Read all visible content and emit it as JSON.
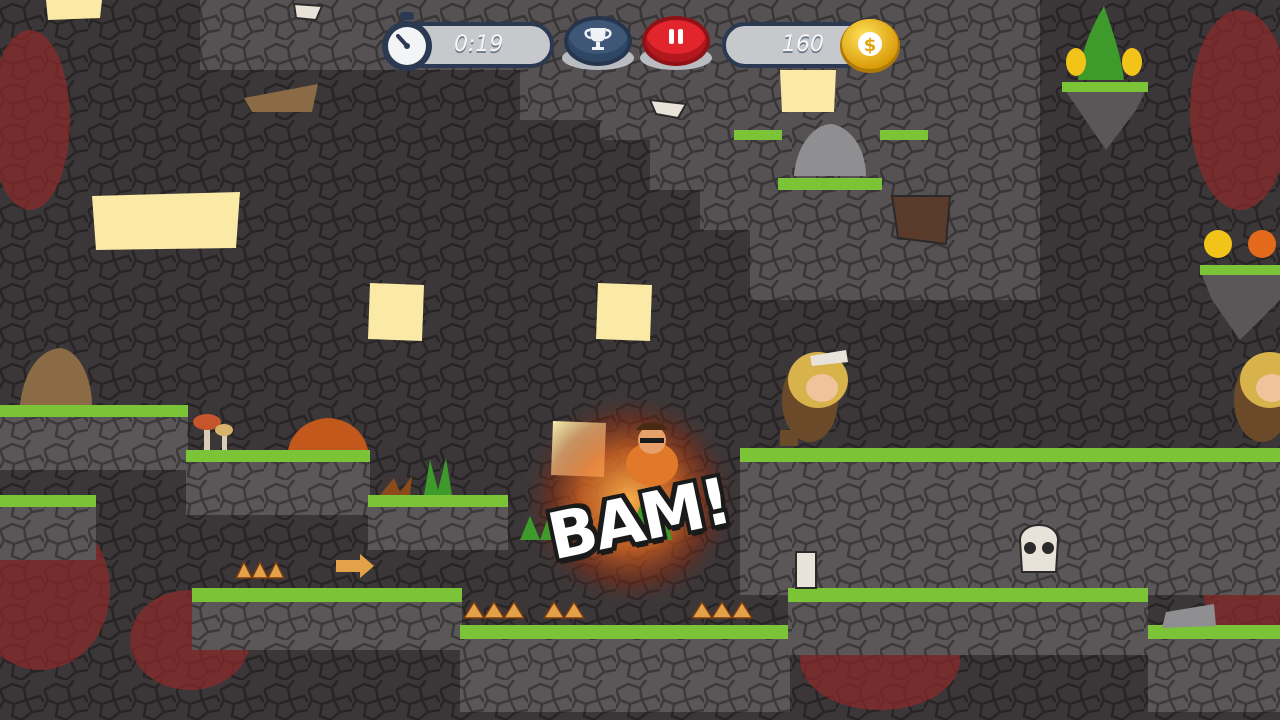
{
  "hud": {
    "timer_icon": "stopwatch-icon",
    "timer_value": "0:19",
    "trophy_icon": "trophy-icon",
    "pause_icon": "pause-icon",
    "coins_value": "160",
    "coin_icon": "dollar-coin-icon"
  },
  "effects": {
    "hit_text": "BAM!"
  },
  "colors": {
    "hud_frame": "#2b3a52",
    "hud_fill": "#c6c8cb",
    "pause_red": "#e2242c",
    "trophy_blue": "#3e5777",
    "coin_gold": "#f2c318",
    "grass_green": "#7cc437",
    "stone_dark": "#3a3638",
    "opening_cream": "#fbe9a6",
    "lava_red": "#8e2a2a"
  }
}
